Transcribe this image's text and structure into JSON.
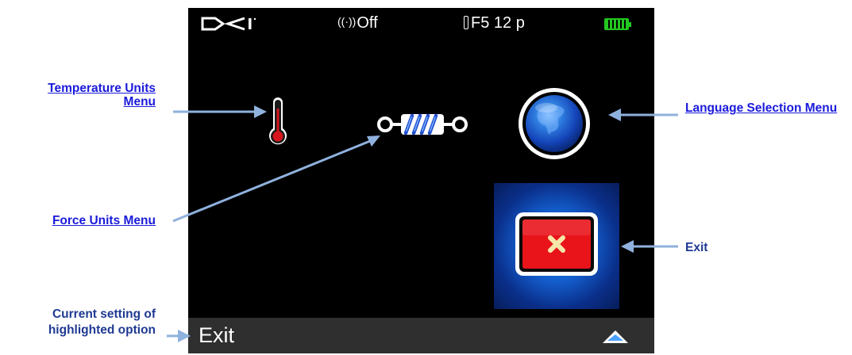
{
  "annotations": {
    "temperature_units": "Temperature Units Menu",
    "language_selection": "Language Selection Menu",
    "force_units": "Force Units Menu",
    "exit": "Exit",
    "current_setting": "Current setting of highlighted option"
  },
  "status_bar": {
    "logo": "DCI",
    "wireless_status": "Off",
    "frequency": "F5 12 p",
    "battery": "battery-full-icon"
  },
  "menu": {
    "items": [
      "thermometer-icon",
      "spring-icon",
      "globe-icon",
      "exit-icon"
    ],
    "highlighted": "exit"
  },
  "bottom_bar": {
    "label": "Exit",
    "arrow": "up-arrow-icon"
  },
  "colors": {
    "annotation_text": "#1a1adb",
    "arrow": "#8fb1dd",
    "highlight": "#1e8cff",
    "battery": "#22c81f",
    "exit_button": "#e8141a"
  }
}
